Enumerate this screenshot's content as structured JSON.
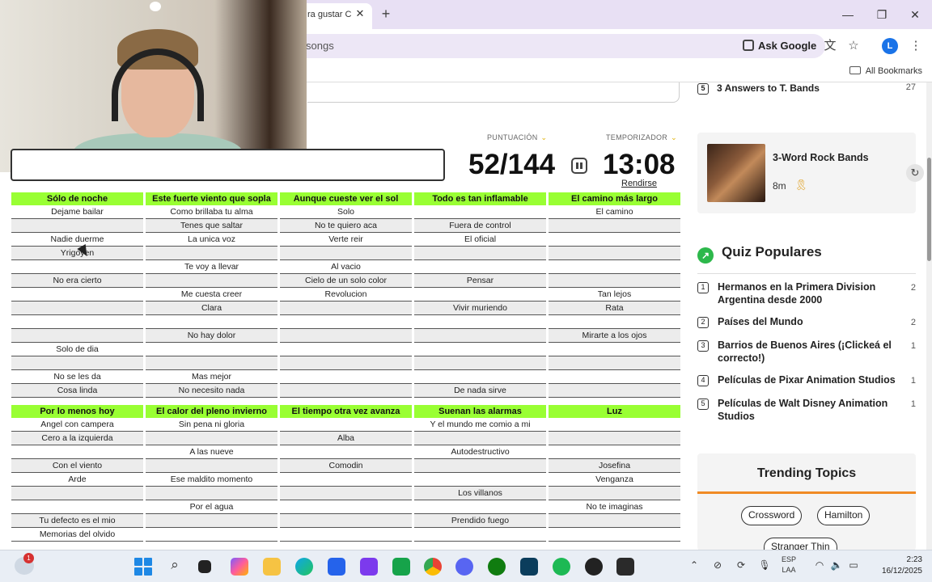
{
  "browser": {
    "tab_title": "ra gustar C",
    "omnibox_text": "songs",
    "ask_google": "Ask Google",
    "avatar_letter": "L",
    "all_bookmarks": "All Bookmarks"
  },
  "quiz": {
    "score_label": "PUNTUACIÓN",
    "timer_label": "TEMPORIZADOR",
    "score": "52/144",
    "timer": "13:08",
    "give_up": "Rendirse",
    "categories_top": [
      {
        "title": "Sólo de noche",
        "answers": [
          "Dejame bailar",
          "",
          "Nadie duerme",
          "Yrigoyen",
          "",
          "No era cierto",
          "",
          "",
          "",
          "",
          "Solo de dia",
          "",
          "No se les da",
          "Cosa linda"
        ]
      },
      {
        "title": "Este fuerte viento que sopla",
        "answers": [
          "Como brillaba tu alma",
          "Tenes que saltar",
          "La unica voz",
          "",
          "Te voy a llevar",
          "",
          "Me cuesta creer",
          "Clara",
          "",
          "No hay dolor",
          "",
          "",
          "Mas mejor",
          "No necesito nada"
        ]
      },
      {
        "title": "Aunque cueste ver el sol",
        "answers": [
          "Solo",
          "No te quiero aca",
          "Verte reir",
          "",
          "Al vacio",
          "Cielo de un solo color",
          "Revolucion",
          "",
          "",
          "",
          "",
          "",
          "",
          ""
        ]
      },
      {
        "title": "Todo es tan inflamable",
        "answers": [
          "",
          "Fuera de control",
          "El oficial",
          "",
          "",
          "Pensar",
          "",
          "Vivir muriendo",
          "",
          "",
          "",
          "",
          "",
          "De nada sirve"
        ]
      },
      {
        "title": "El camino más largo",
        "answers": [
          "El camino",
          "",
          "",
          "",
          "",
          "",
          "Tan lejos",
          "Rata",
          "",
          "Mirarte a los ojos",
          "",
          "",
          "",
          ""
        ]
      }
    ],
    "categories_bottom": [
      {
        "title": "Por lo menos hoy",
        "answers": [
          "Angel con campera",
          "Cero a la izquierda",
          "",
          "Con el viento",
          "Arde",
          "",
          "",
          "Tu defecto es el mio",
          "Memorias del olvido"
        ]
      },
      {
        "title": "El calor del pleno invierno",
        "answers": [
          "Sin pena ni gloria",
          "",
          "A las nueve",
          "",
          "Ese maldito momento",
          "",
          "Por el agua",
          "",
          ""
        ]
      },
      {
        "title": "El tiempo otra vez avanza",
        "answers": [
          "",
          "Alba",
          "",
          "Comodin",
          "",
          "",
          "",
          "",
          ""
        ]
      },
      {
        "title": "Suenan las alarmas",
        "answers": [
          "Y el mundo me comio a mi",
          "",
          "Autodestructivo",
          "",
          "",
          "Los villanos",
          "",
          "Prendido fuego",
          ""
        ]
      },
      {
        "title": "Luz",
        "answers": [
          "",
          "",
          "",
          "Josefina",
          "Venganza",
          "",
          "No te imaginas",
          "",
          ""
        ]
      }
    ]
  },
  "sidebar": {
    "prev_item": {
      "num": "5",
      "text": "3 Answers to T. Bands",
      "count": "27"
    },
    "card": {
      "title": "3-Word Rock Bands",
      "time": "8m"
    },
    "popular_title": "Quiz Populares",
    "popular": [
      {
        "num": "1",
        "text": "Hermanos en la Primera Division Argentina desde 2000",
        "count": "2"
      },
      {
        "num": "2",
        "text": "Países del Mundo",
        "count": "2"
      },
      {
        "num": "3",
        "text": "Barrios de Buenos Aires (¡Clickeá el correcto!)",
        "count": "1"
      },
      {
        "num": "4",
        "text": "Películas de Pixar Animation Studios",
        "count": "1"
      },
      {
        "num": "5",
        "text": "Películas de Walt Disney Animation Studios",
        "count": "1"
      }
    ],
    "trending_title": "Trending Topics",
    "chips": [
      "Crossword",
      "Hamilton",
      "Stranger Thin"
    ]
  },
  "taskbar": {
    "notif_count": "1",
    "lang_line1": "ESP",
    "lang_line2": "LAA",
    "time": "2:23",
    "date": "16/12/2025"
  },
  "icons": {
    "start": "windows-logo",
    "search": "magnifier",
    "accent": "#99ff33",
    "trend_underline": "#f08a24"
  }
}
